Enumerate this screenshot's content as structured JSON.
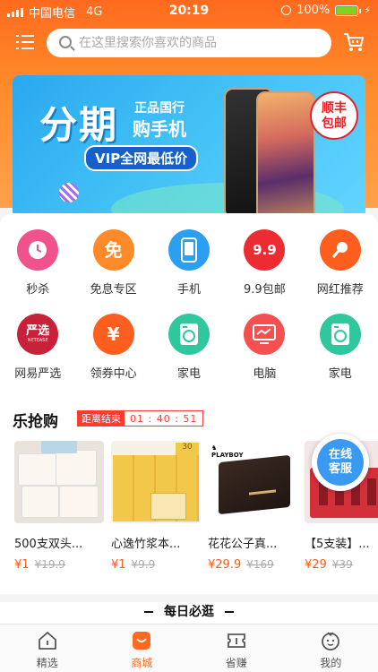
{
  "status_bar": {
    "carrier": "中国电信",
    "network": "4G",
    "time": "20:19",
    "battery": "100%"
  },
  "search": {
    "placeholder": "在这里搜索你喜欢的商品"
  },
  "banner": {
    "headline": "分期",
    "line1": "正品国行",
    "line2": "购手机",
    "pill": "VIP全网最低价",
    "badge": "顺丰包邮"
  },
  "categories": [
    {
      "label": "秒杀",
      "icon": "clock-icon",
      "color": "#f0528c"
    },
    {
      "label": "免息专区",
      "icon": "free-interest-icon",
      "glyph": "免",
      "color": "#ff8a2a"
    },
    {
      "label": "手机",
      "icon": "phone-icon",
      "color": "#2c9ff0"
    },
    {
      "label": "9.9包邮",
      "icon": "nine-nine-icon",
      "glyph": "9.9",
      "color": "#ec2b33"
    },
    {
      "label": "网红推荐",
      "icon": "microphone-icon",
      "color": "#ff5e1f"
    },
    {
      "label": "网易严选",
      "icon": "netease-yanxuan-icon",
      "glyph": "严选",
      "sub": "NETEASE",
      "color": "#c7223a"
    },
    {
      "label": "领券中心",
      "icon": "coupon-icon",
      "glyph": "¥",
      "color": "#ff5e1f"
    },
    {
      "label": "家电",
      "icon": "washing-machine-icon",
      "color": "#2fc79b"
    },
    {
      "label": "电脑",
      "icon": "monitor-icon",
      "color": "#f54f4f"
    },
    {
      "label": "家电",
      "icon": "washing-machine-icon",
      "color": "#2fc79b"
    }
  ],
  "flash_sale": {
    "title": "乐抢购",
    "countdown_label": "距离结束",
    "countdown_time": "01 : 40 : 51"
  },
  "products": [
    {
      "name": "500支双头...",
      "price": "¥1",
      "old_price": "¥19.9"
    },
    {
      "name": "心逸竹浆本...",
      "price": "¥1",
      "old_price": "¥9.9"
    },
    {
      "name": "花花公子真...",
      "price": "¥29.9",
      "old_price": "¥169"
    },
    {
      "name": "【5支装】...",
      "price": "¥29",
      "old_price": "¥39"
    }
  ],
  "customer_service": {
    "label": "在线客服"
  },
  "daily_section": {
    "title": "每日必逛"
  },
  "tabbar": [
    {
      "label": "精选",
      "icon": "home-icon",
      "active": false
    },
    {
      "label": "商城",
      "icon": "shop-bag-icon",
      "active": true
    },
    {
      "label": "省赚",
      "icon": "coupon-ticket-icon",
      "active": false
    },
    {
      "label": "我的",
      "icon": "profile-face-icon",
      "active": false
    }
  ],
  "colors": {
    "brand_orange": "#ff6a1e",
    "price_red": "#ff5a1f",
    "timer_red": "#ff3b30"
  }
}
